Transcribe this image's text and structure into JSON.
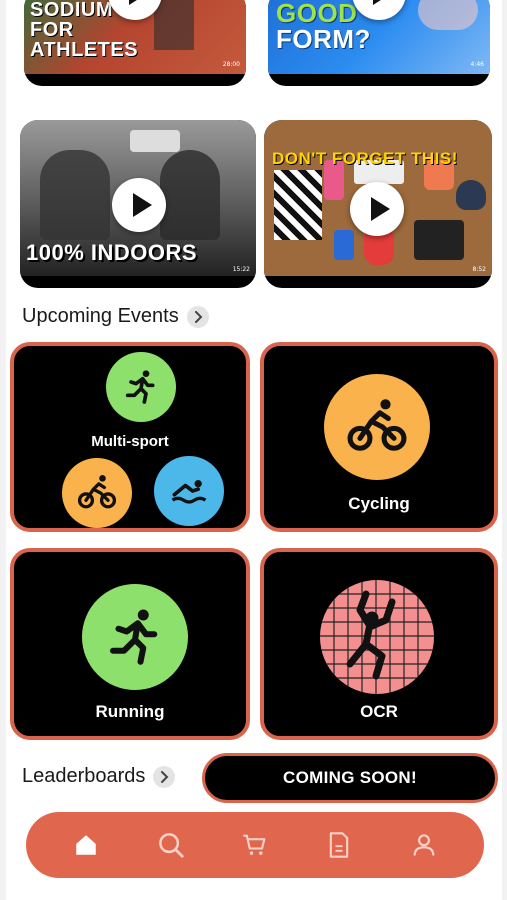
{
  "videos": [
    {
      "caption": "SODIUM\nFOR\nATHLETES",
      "line1": "SODIUM",
      "line2": "FOR",
      "line3": "ATHLETES",
      "duration": "28:00"
    },
    {
      "line1": "GOOD",
      "line2": "FORM?",
      "duration": "4:46"
    },
    {
      "caption": "100% INDOORS",
      "duration": "15:22"
    },
    {
      "caption": "DON'T FORGET THIS!",
      "duration": "8:52"
    }
  ],
  "upcoming": {
    "title": "Upcoming Events"
  },
  "events": [
    {
      "label": "Multi-sport"
    },
    {
      "label": "Cycling"
    },
    {
      "label": "Running"
    },
    {
      "label": "OCR"
    }
  ],
  "leaderboards": {
    "title": "Leaderboards",
    "badge": "COMING SOON!"
  },
  "nav": {
    "items": [
      "home-icon",
      "search-icon",
      "cart-icon",
      "document-icon",
      "profile-icon"
    ]
  },
  "colors": {
    "accent": "#d9644c",
    "green": "#8ee06c",
    "orange": "#f9b24c",
    "blue": "#4cb8ea",
    "pink": "#f48f8f"
  }
}
